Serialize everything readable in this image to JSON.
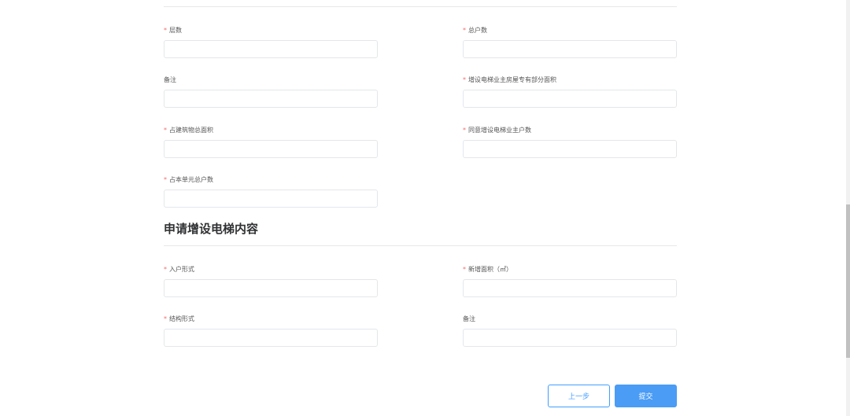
{
  "section1": {
    "fields": [
      {
        "label": "层数",
        "required": true
      },
      {
        "label": "总户数",
        "required": true
      },
      {
        "label": "备注",
        "required": false
      },
      {
        "label": "增设电梯业主房屋专有部分面积",
        "required": true
      },
      {
        "label": "占建筑物总面积",
        "required": true
      },
      {
        "label": "同意增设电梯业主户数",
        "required": true
      },
      {
        "label": "占本单元总户数",
        "required": true
      }
    ]
  },
  "section2": {
    "title": "申请增设电梯内容",
    "fields": [
      {
        "label": "入户形式",
        "required": true
      },
      {
        "label": "新增面积（㎡）",
        "required": true
      },
      {
        "label": "结构形式",
        "required": true
      },
      {
        "label": "备注",
        "required": false
      }
    ]
  },
  "buttons": {
    "prev": "上一步",
    "submit": "提交"
  },
  "required_mark": "*"
}
